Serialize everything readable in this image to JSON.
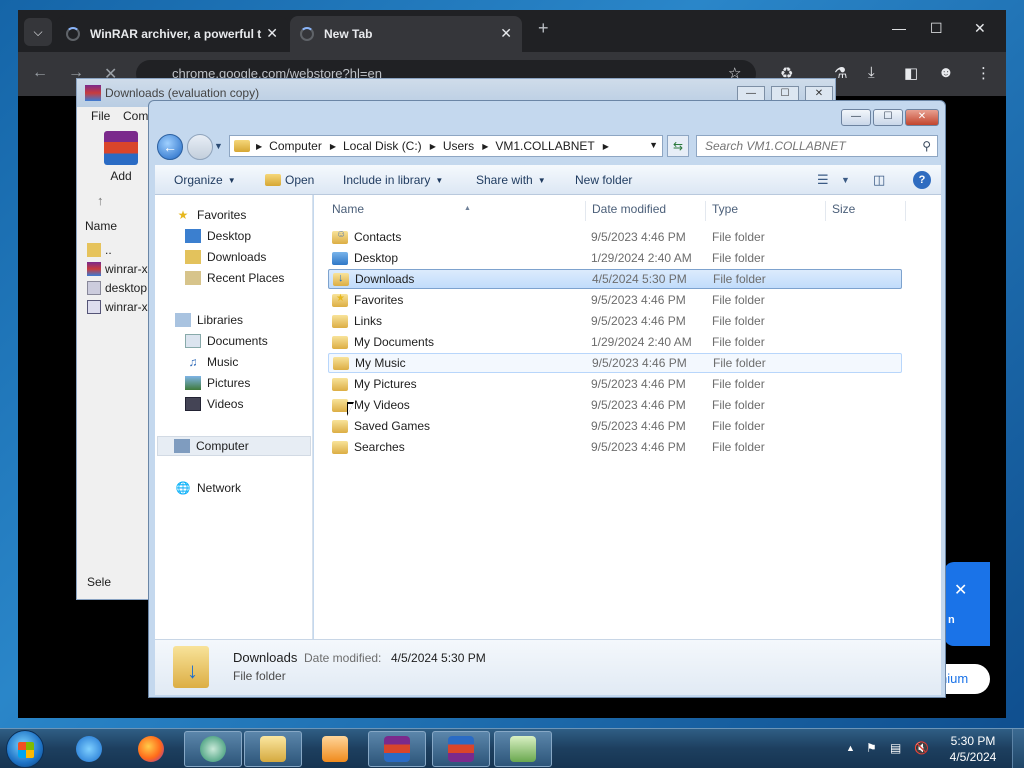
{
  "chrome": {
    "tabs": [
      {
        "title": "WinRAR archiver, a powerful t",
        "loading": true
      },
      {
        "title": "New Tab",
        "loading": true
      }
    ],
    "address": "chrome.google.com/webstore?hl=en",
    "promo_text": "n",
    "pill_text": "nium"
  },
  "winrar": {
    "title": "Downloads (evaluation copy)",
    "menu": [
      "File",
      "Com"
    ],
    "add_label": "Add",
    "column_name": "Name",
    "rows": [
      "..",
      "winrar-x",
      "desktop",
      "winrar-x"
    ],
    "status": "Sele"
  },
  "explorer": {
    "breadcrumbs": [
      "Computer",
      "Local Disk (C:)",
      "Users",
      "VM1.COLLABNET"
    ],
    "search_placeholder": "Search VM1.COLLABNET",
    "commands": {
      "organize": "Organize",
      "open": "Open",
      "include": "Include in library",
      "share": "Share with",
      "new_folder": "New folder"
    },
    "nav": {
      "favorites": "Favorites",
      "favorites_items": [
        "Desktop",
        "Downloads",
        "Recent Places"
      ],
      "libraries": "Libraries",
      "libraries_items": [
        "Documents",
        "Music",
        "Pictures",
        "Videos"
      ],
      "computer": "Computer",
      "network": "Network"
    },
    "columns": {
      "name": "Name",
      "date": "Date modified",
      "type": "Type",
      "size": "Size"
    },
    "files": [
      {
        "name": "Contacts",
        "date": "9/5/2023 4:46 PM",
        "type": "File folder",
        "icon": "contacts-folder"
      },
      {
        "name": "Desktop",
        "date": "1/29/2024 2:40 AM",
        "type": "File folder",
        "icon": "desktop-folder"
      },
      {
        "name": "Downloads",
        "date": "4/5/2024 5:30 PM",
        "type": "File folder",
        "icon": "downloads-folder"
      },
      {
        "name": "Favorites",
        "date": "9/5/2023 4:46 PM",
        "type": "File folder",
        "icon": "favorites-folder"
      },
      {
        "name": "Links",
        "date": "9/5/2023 4:46 PM",
        "type": "File folder",
        "icon": "folder"
      },
      {
        "name": "My Documents",
        "date": "1/29/2024 2:40 AM",
        "type": "File folder",
        "icon": "folder"
      },
      {
        "name": "My Music",
        "date": "9/5/2023 4:46 PM",
        "type": "File folder",
        "icon": "folder"
      },
      {
        "name": "My Pictures",
        "date": "9/5/2023 4:46 PM",
        "type": "File folder",
        "icon": "folder"
      },
      {
        "name": "My Videos",
        "date": "9/5/2023 4:46 PM",
        "type": "File folder",
        "icon": "folder"
      },
      {
        "name": "Saved Games",
        "date": "9/5/2023 4:46 PM",
        "type": "File folder",
        "icon": "folder"
      },
      {
        "name": "Searches",
        "date": "9/5/2023 4:46 PM",
        "type": "File folder",
        "icon": "folder"
      }
    ],
    "details": {
      "name": "Downloads",
      "modified_label": "Date modified:",
      "modified_value": "4/5/2024 5:30 PM",
      "type": "File folder"
    }
  },
  "taskbar": {
    "time": "5:30 PM",
    "date": "4/5/2024"
  },
  "colors": {
    "accent": "#1a73e8",
    "selection": "#c1dcfb",
    "taskbar": "#1d3f5f"
  }
}
